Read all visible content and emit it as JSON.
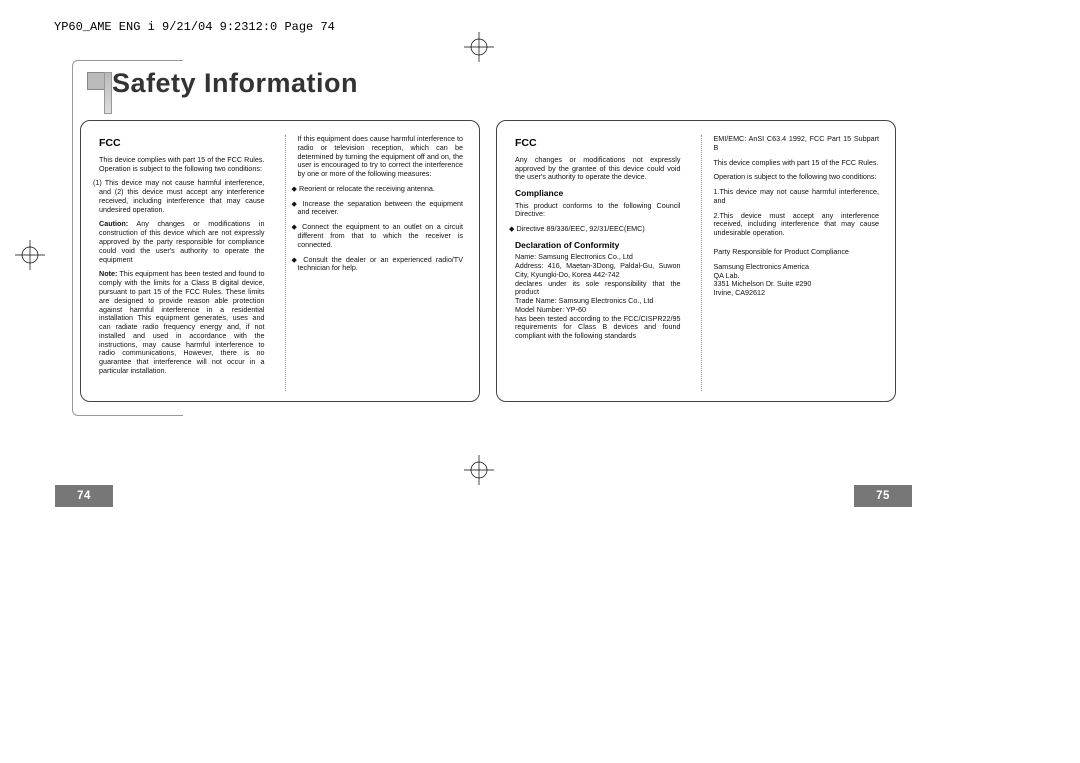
{
  "header": "YP60_AME ENG i  9/21/04 9:2312:0  Page 74",
  "title": "Safety Information",
  "left": {
    "h1": "FCC",
    "p1": "This device complies with part 15 of the FCC Rules. Operation is subject to the following two conditions:",
    "p2": "(1) This device may not cause harmful interference, and (2) this device must accept any interference received, including interference that may cause undesired operation.",
    "p3a": "Caution:",
    "p3": " Any changes or modifications in construction of this device which are not expressly approved by the party responsible for compliance could void the user's authority to operate the equipment",
    "p4a": "Note:",
    "p4": " This equipment has been tested and found to comply with the limits for a Class B digital device, pursuant to part 15 of the FCC Rules. These limits are designed to provide reason able protection against harmful interference in a residential installation This equipment generates, uses and can radiate radio frequency energy and, if not installed and used in accordance with the instructions, may cause harmful interference to radio communications, However, there is no guarantee that interference will not occur in a particular installation.",
    "p5": "If this equipment does cause harmful interference to radio or television reception, which can  be determined by turning the equipment off and on, the user is encouraged to try to correct the interference by one or more of the following measures:",
    "b1": "◆ Reorient or relocate the receiving antenna.",
    "b2": "◆ Increase the separation between the equipment and receiver.",
    "b3": "◆ Connect the equipment to an outlet on a circuit different from that to which the receiver is connected.",
    "b4": "◆ Consult the dealer or an experienced radio/TV technician for help."
  },
  "right": {
    "h1": "FCC",
    "p1": "Any changes or modifications not expressly approved by the grantee of this device could void the user's authority to operate the device.",
    "h2": "Compliance",
    "p2": "This product conforms to the following Council Directive:",
    "p3": "◆ Directive 89/336/EEC, 92/31/EEC(EMC)",
    "h3": "Declaration of Conformity",
    "p4": "Name: Samsung Electronics Co., Ltd\nAddress: 416, Maetan-3Dong, Paldal-Gu, Suwon City, Kyungki-Do, Korea 442-742\ndeclares under its sole responsibility that the product\nTrade Name: Samsung Electronics Co., Ltd\nModel Number:  YP-60\nhas been tested according to the FCC/CISPR22/95 requirements for Class B devices and found compliant with the following standards",
    "p5": "EMI/EMC: AnSI C63.4 1992, FCC Part 15 Subpart B",
    "p6": "This device complies with part 15 of the FCC Rules.",
    "p7": "Operation is subject to the following two conditions:",
    "p8": "1.This device may not cause harmful interference, and",
    "p9": "2.This device must accept any interference received, including interference that may cause undesirable operation.",
    "p10": "Party Responsible for Product Compliance",
    "p11": "Samsung Electronics America\nQA Lab.\n3351 Michelson Dr. Suite #290\nIrvine, CA92612"
  },
  "pages": {
    "left": "74",
    "right": "75"
  }
}
